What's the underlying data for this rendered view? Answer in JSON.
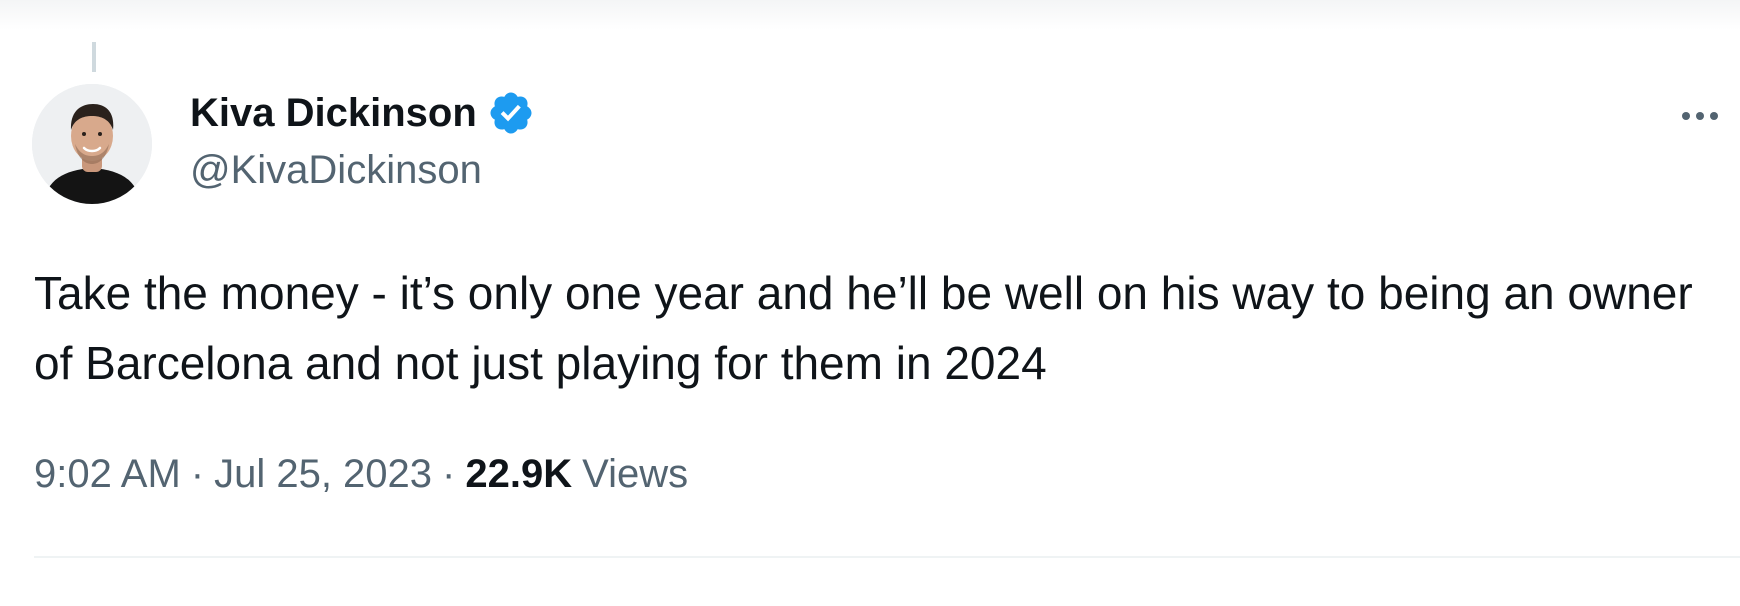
{
  "author": {
    "display_name": "Kiva Dickinson",
    "handle": "@KivaDickinson",
    "verified": true,
    "verified_icon": "verified-badge-icon",
    "verified_color": "#1d9bf0",
    "avatar_icon": "profile-photo"
  },
  "menu": {
    "icon": "more-horizontal-icon"
  },
  "tweet": {
    "text": "Take the money - it’s only one year and he’ll be well on his way to being an owner of Barcelona and not just playing for them in 2024",
    "time": "9:02 AM",
    "date": "Jul 25, 2023",
    "separator": "·",
    "views_count": "22.9K",
    "views_label": "Views"
  },
  "colors": {
    "text_primary": "#0f1419",
    "text_secondary": "#536471",
    "divider": "#eff3f4"
  }
}
